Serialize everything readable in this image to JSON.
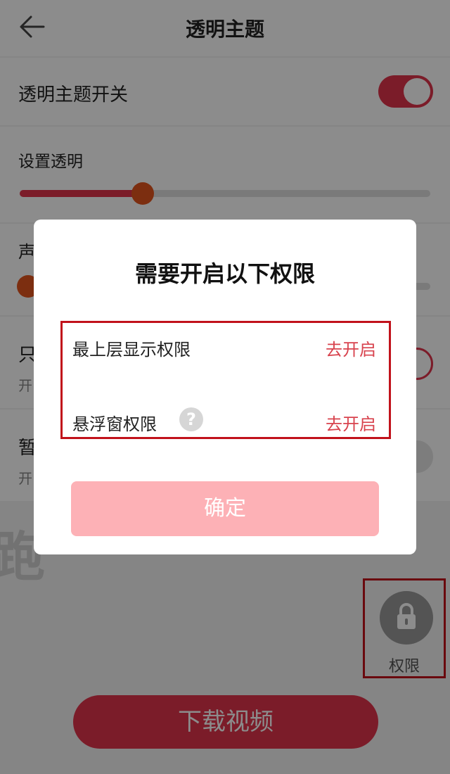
{
  "header": {
    "title": "透明主题"
  },
  "settings": {
    "toggle_label": "透明主题开关",
    "transparency_label": "设置透明",
    "transparency_value": 0.3,
    "sound_label_partial": "声",
    "sound_value": 0.02,
    "option1_label_partial": "只",
    "option1_sub_partial": "开",
    "option2_label_partial": "暂",
    "option2_sub_partial": "开",
    "bg_glyph_partial": "跑"
  },
  "float_button": {
    "label": "权限"
  },
  "download_button": {
    "label": "下载视频"
  },
  "dialog": {
    "title": "需要开启以下权限",
    "permissions": [
      {
        "name": "最上层显示权限",
        "action": "去开启"
      },
      {
        "name": "悬浮窗权限",
        "action": "去开启",
        "help": "?"
      }
    ],
    "confirm_label": "确定"
  },
  "colors": {
    "accent": "#e0334b",
    "highlight_border": "#c1121b",
    "action_text": "#d8434e",
    "confirm_bg": "#fdb1b6"
  }
}
